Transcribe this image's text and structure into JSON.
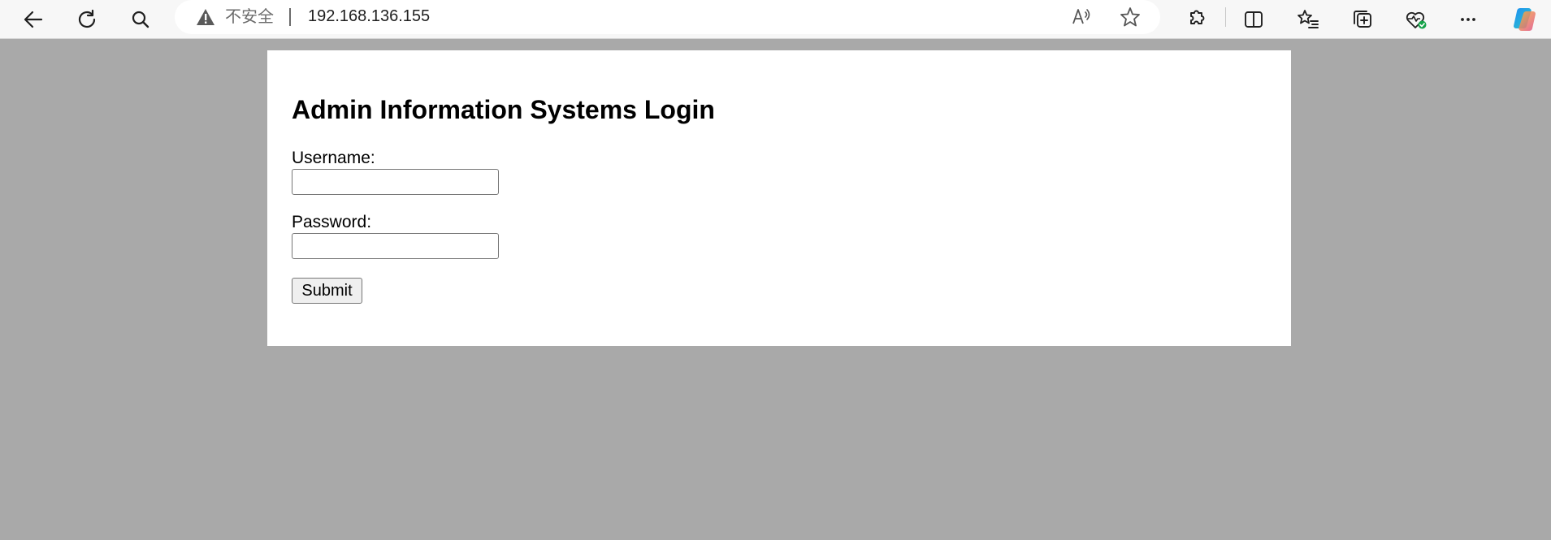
{
  "browser": {
    "security_label": "不安全",
    "url": "192.168.136.155",
    "icons": {
      "back": "back-arrow-icon",
      "refresh": "refresh-icon",
      "search": "search-icon",
      "warning": "warning-triangle-icon",
      "read_aloud": "read-aloud-icon",
      "favorite": "star-icon",
      "extensions": "puzzle-icon",
      "split_screen": "split-screen-icon",
      "favorites": "favorites-list-icon",
      "collections": "collections-icon",
      "browser_essentials": "heart-pulse-icon",
      "more": "more-dots-icon",
      "copilot": "copilot-icon"
    }
  },
  "page": {
    "title": "Admin Information Systems Login",
    "username_label": "Username:",
    "username_value": "",
    "password_label": "Password:",
    "password_value": "",
    "submit_label": "Submit"
  },
  "colors": {
    "page_background": "#a9a9a9",
    "panel_background": "#ffffff"
  }
}
